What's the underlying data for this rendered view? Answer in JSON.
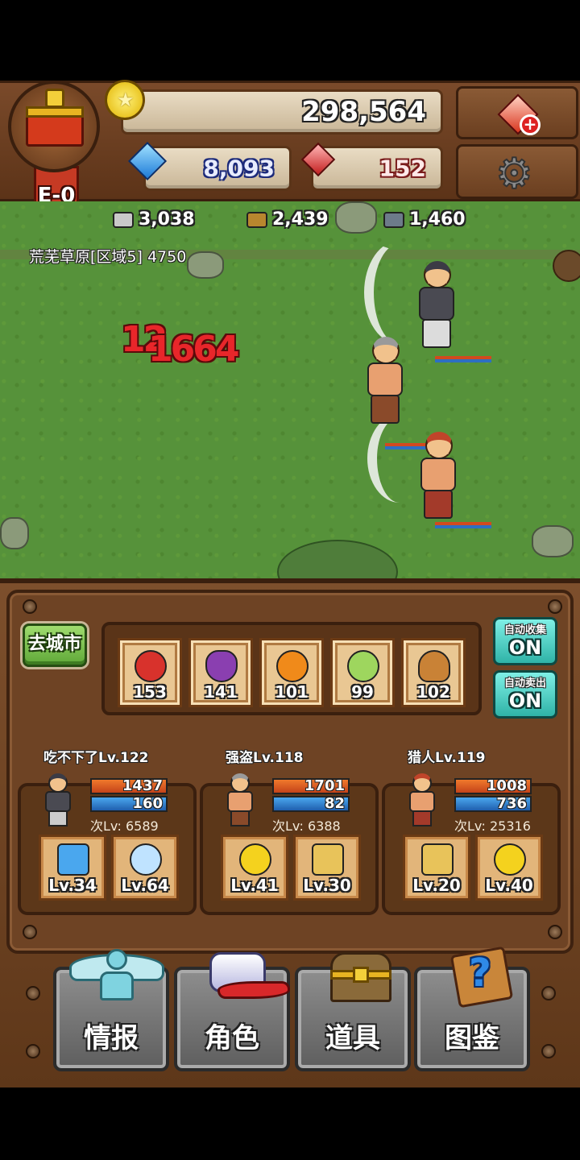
{
  "hud": {
    "rank_badge": "E-0",
    "gold": "298,564",
    "gems": "8,093",
    "rubies": "152"
  },
  "field": {
    "resources": [
      {
        "name": "stone",
        "value": "3,038",
        "color": "#c9c9c9"
      },
      {
        "name": "wood",
        "value": "2,439",
        "color": "#b8862e"
      },
      {
        "name": "ore",
        "value": "1,460",
        "color": "#6d7b8a"
      }
    ],
    "zone_label": "荒芜草原[区域5] 4750",
    "damage_numbers": [
      "12",
      "1664"
    ]
  },
  "controls": {
    "go_to_city": "去城市",
    "auto_collect_label": "自动收集",
    "auto_collect_value": "ON",
    "auto_sell_label": "自动卖出",
    "auto_sell_value": "ON"
  },
  "fruits": [
    {
      "name": "apple",
      "count": "153",
      "color": "#d8322c"
    },
    {
      "name": "grape",
      "count": "141",
      "color": "#8a3fb0"
    },
    {
      "name": "orange",
      "count": "101",
      "color": "#f08a1a"
    },
    {
      "name": "melon",
      "count": "99",
      "color": "#9ed65e"
    },
    {
      "name": "bread",
      "count": "102",
      "color": "#c98236"
    }
  ],
  "characters": [
    {
      "name": "吃不下了Lv.122",
      "hp": "1437",
      "mp": "160",
      "next_lv": "次Lv: 6589",
      "skills": [
        {
          "icon": "comet-icon",
          "lv": "Lv.34",
          "color": "#4aa7ee"
        },
        {
          "icon": "orb-icon",
          "lv": "Lv.64",
          "color": "#bfe3ff"
        }
      ],
      "cloth": "#4a4a52"
    },
    {
      "name": "强盗Lv.118",
      "hp": "1701",
      "mp": "82",
      "next_lv": "次Lv: 6388",
      "skills": [
        {
          "icon": "burst-icon",
          "lv": "Lv.41",
          "color": "#f4d21e"
        },
        {
          "icon": "cross-swords-icon",
          "lv": "Lv.30",
          "color": "#e8c35a"
        }
      ],
      "cloth": "#8a4a2a"
    },
    {
      "name": "猎人Lv.119",
      "hp": "1008",
      "mp": "736",
      "next_lv": "次Lv: 25316",
      "skills": [
        {
          "icon": "cross-swords-icon",
          "lv": "Lv.20",
          "color": "#e8c35a"
        },
        {
          "icon": "burst-icon",
          "lv": "Lv.40",
          "color": "#f4d21e"
        }
      ],
      "cloth": "#a33a2a"
    }
  ],
  "nav": [
    {
      "label": "情报",
      "icon": "winged-person-icon"
    },
    {
      "label": "角色",
      "icon": "helmet-feather-icon"
    },
    {
      "label": "道具",
      "icon": "treasure-chest-icon"
    },
    {
      "label": "图鉴",
      "icon": "question-book-icon"
    }
  ]
}
